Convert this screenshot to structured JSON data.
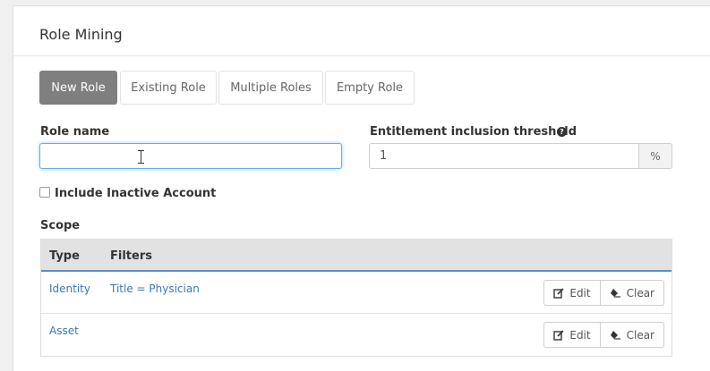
{
  "panel": {
    "title": "Role Mining"
  },
  "tabs": [
    {
      "label": "New Role",
      "active": true
    },
    {
      "label": "Existing Role",
      "active": false
    },
    {
      "label": "Multiple Roles",
      "active": false
    },
    {
      "label": "Empty Role",
      "active": false
    }
  ],
  "form": {
    "role_name_label": "Role name",
    "role_name_value": "",
    "threshold_label": "Entitlement inclusion threshold",
    "threshold_value": "1",
    "threshold_unit": "%",
    "help_icon": "question-circle-icon",
    "include_inactive_label": "Include Inactive Account",
    "include_inactive_checked": false
  },
  "scope": {
    "label": "Scope",
    "columns": [
      "Type",
      "Filters"
    ],
    "rows": [
      {
        "type": "Identity",
        "filter": "Title = Physician"
      },
      {
        "type": "Asset",
        "filter": ""
      }
    ],
    "edit_label": "Edit",
    "clear_label": "Clear"
  },
  "colors": {
    "active_tab": "#7f7f7f",
    "link": "#3a78b5",
    "header_border": "#5b8fc7",
    "focus_border": "#66afe9"
  }
}
